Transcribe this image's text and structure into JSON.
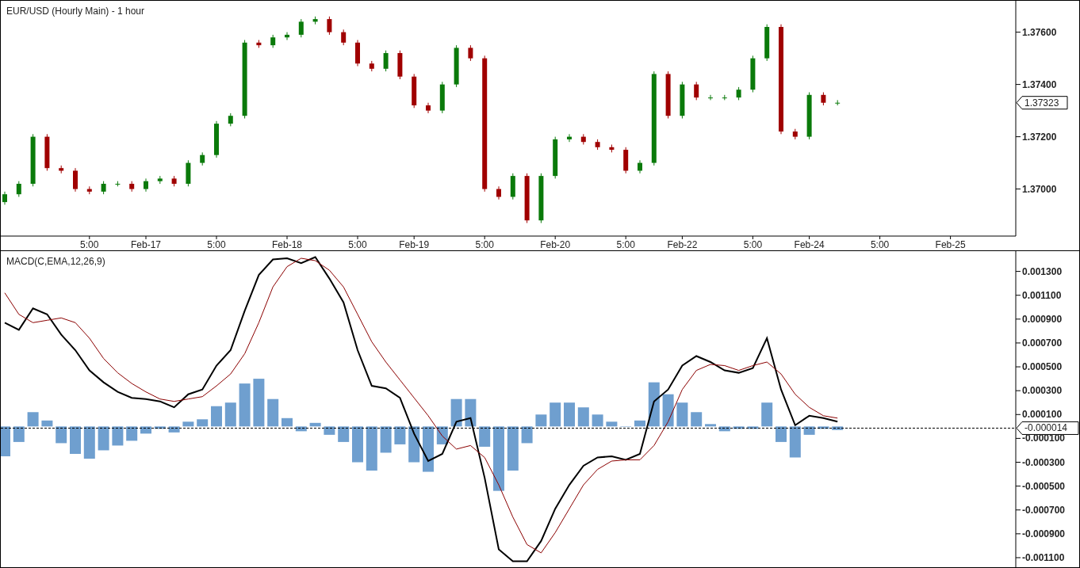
{
  "price_chart": {
    "chart_data": {
      "type": "candlestick",
      "title": "EUR/USD (Hourly Main) - 1 hour",
      "ylim": [
        1.3682,
        1.3772
      ],
      "categories": [
        null,
        null,
        null,
        null,
        null,
        null,
        "5:00",
        null,
        null,
        null,
        "Feb-17",
        null,
        null,
        null,
        null,
        "5:00",
        null,
        null,
        null,
        null,
        "Feb-18",
        null,
        null,
        null,
        null,
        "5:00",
        null,
        null,
        null,
        "Feb-19",
        null,
        null,
        null,
        null,
        "5:00",
        null,
        null,
        null,
        null,
        "Feb-20",
        null,
        null,
        null,
        null,
        "5:00",
        null,
        null,
        null,
        "Feb-22",
        null,
        null,
        null,
        null,
        "5:00",
        null,
        null,
        null,
        "Feb-24",
        null,
        null,
        null,
        null,
        "5:00",
        null,
        null,
        null,
        null,
        "Feb-25",
        null,
        null,
        null,
        null
      ],
      "yticks": [
        {
          "value": 1.376,
          "label": "1.37600"
        },
        {
          "value": 1.374,
          "label": "1.37400"
        },
        {
          "value": 1.372,
          "label": "1.37200"
        },
        {
          "value": 1.37,
          "label": "1.37000"
        }
      ],
      "ohlc": [
        [
          1.3695,
          1.3699,
          1.3694,
          1.3698
        ],
        [
          1.3698,
          1.3703,
          1.3697,
          1.3702
        ],
        [
          1.3702,
          1.3721,
          1.3701,
          1.372
        ],
        [
          1.372,
          1.3721,
          1.3707,
          1.3708
        ],
        [
          1.3708,
          1.3709,
          1.3706,
          1.3707
        ],
        [
          1.3707,
          1.3708,
          1.3699,
          1.37
        ],
        [
          1.37,
          1.3701,
          1.3698,
          1.3699
        ],
        [
          1.3699,
          1.3703,
          1.3698,
          1.3702
        ],
        [
          1.3702,
          1.3703,
          1.3701,
          1.3702
        ],
        [
          1.3702,
          1.3703,
          1.3699,
          1.37
        ],
        [
          1.37,
          1.3704,
          1.3699,
          1.3703
        ],
        [
          1.3703,
          1.3705,
          1.3702,
          1.3704
        ],
        [
          1.3704,
          1.3705,
          1.3701,
          1.3702
        ],
        [
          1.3702,
          1.3711,
          1.3701,
          1.371
        ],
        [
          1.371,
          1.3714,
          1.3709,
          1.3713
        ],
        [
          1.3713,
          1.3726,
          1.3712,
          1.3725
        ],
        [
          1.3725,
          1.3729,
          1.3724,
          1.3728
        ],
        [
          1.3728,
          1.3757,
          1.3727,
          1.3756
        ],
        [
          1.3756,
          1.3757,
          1.3754,
          1.3755
        ],
        [
          1.3755,
          1.3759,
          1.3754,
          1.3758
        ],
        [
          1.3758,
          1.376,
          1.3757,
          1.3759
        ],
        [
          1.3759,
          1.3765,
          1.3758,
          1.3764
        ],
        [
          1.3764,
          1.3766,
          1.3763,
          1.3765
        ],
        [
          1.3765,
          1.3766,
          1.3759,
          1.376
        ],
        [
          1.376,
          1.3761,
          1.3755,
          1.3756
        ],
        [
          1.3756,
          1.3757,
          1.3747,
          1.3748
        ],
        [
          1.3748,
          1.3749,
          1.3745,
          1.3746
        ],
        [
          1.3746,
          1.3753,
          1.3745,
          1.3752
        ],
        [
          1.3752,
          1.3753,
          1.3742,
          1.3743
        ],
        [
          1.3743,
          1.3744,
          1.3731,
          1.3732
        ],
        [
          1.3732,
          1.3733,
          1.3729,
          1.373
        ],
        [
          1.373,
          1.3741,
          1.3729,
          1.374
        ],
        [
          1.374,
          1.3755,
          1.3739,
          1.3754
        ],
        [
          1.3754,
          1.3755,
          1.3749,
          1.375
        ],
        [
          1.375,
          1.3751,
          1.3699,
          1.37
        ],
        [
          1.37,
          1.3701,
          1.3696,
          1.3697
        ],
        [
          1.3697,
          1.3706,
          1.3696,
          1.3705
        ],
        [
          1.3705,
          1.3706,
          1.3687,
          1.3688
        ],
        [
          1.3688,
          1.3706,
          1.3687,
          1.3705
        ],
        [
          1.3705,
          1.372,
          1.3704,
          1.3719
        ],
        [
          1.3719,
          1.3721,
          1.3718,
          1.372
        ],
        [
          1.372,
          1.3721,
          1.3717,
          1.3718
        ],
        [
          1.3718,
          1.3719,
          1.3715,
          1.3716
        ],
        [
          1.3716,
          1.3717,
          1.3714,
          1.3715
        ],
        [
          1.3715,
          1.3716,
          1.3706,
          1.3707
        ],
        [
          1.3707,
          1.3711,
          1.3706,
          1.371
        ],
        [
          1.371,
          1.3745,
          1.3709,
          1.3744
        ],
        [
          1.3744,
          1.3745,
          1.3727,
          1.3728
        ],
        [
          1.3728,
          1.3741,
          1.3727,
          1.374
        ],
        [
          1.374,
          1.3741,
          1.3734,
          1.3735
        ],
        [
          1.3735,
          1.3736,
          1.3734,
          1.3735
        ],
        [
          1.3735,
          1.3736,
          1.3734,
          1.3735
        ],
        [
          1.3735,
          1.3739,
          1.3734,
          1.3738
        ],
        [
          1.3738,
          1.3751,
          1.3737,
          1.375
        ],
        [
          1.375,
          1.3763,
          1.3749,
          1.3762
        ],
        [
          1.3762,
          1.3763,
          1.3721,
          1.3722
        ],
        [
          1.3722,
          1.3723,
          1.3719,
          1.372
        ],
        [
          1.372,
          1.3737,
          1.3719,
          1.3736
        ],
        [
          1.3736,
          1.3737,
          1.3732,
          1.3733
        ],
        [
          1.3733,
          1.3734,
          1.3732,
          1.3733
        ],
        null,
        null,
        null,
        null,
        null,
        null,
        null,
        null,
        null,
        null,
        null,
        null
      ],
      "annotations": [
        "1.37323"
      ]
    }
  },
  "macd_chart": {
    "chart_data": {
      "type": "line",
      "title": "MACD(C,EMA,12,26,9)",
      "ylim": [
        -0.00118,
        0.00147
      ],
      "yticks": [
        {
          "value": 0.0013,
          "label": "0.001300"
        },
        {
          "value": 0.0011,
          "label": "0.001100"
        },
        {
          "value": 0.0009,
          "label": "0.000900"
        },
        {
          "value": 0.0007,
          "label": "0.000700"
        },
        {
          "value": 0.0005,
          "label": "0.000500"
        },
        {
          "value": 0.0003,
          "label": "0.000300"
        },
        {
          "value": 0.0001,
          "label": "0.000100"
        },
        {
          "value": -0.0001,
          "label": "-0.000100"
        },
        {
          "value": -0.0003,
          "label": "-0.000300"
        },
        {
          "value": -0.0005,
          "label": "-0.000500"
        },
        {
          "value": -0.0007,
          "label": "-0.000700"
        },
        {
          "value": -0.0009,
          "label": "-0.000900"
        },
        {
          "value": -0.0011,
          "label": "-0.001100"
        }
      ],
      "series": [
        {
          "type": "bar",
          "color": "#6f9fcf",
          "values": [
            -0.00025,
            -0.00013,
            0.00012,
            5e-05,
            -0.00014,
            -0.00023,
            -0.00027,
            -0.0002,
            -0.00016,
            -0.00012,
            -6e-05,
            -2e-05,
            -5e-05,
            4e-05,
            6e-05,
            0.00017,
            0.0002,
            0.00036,
            0.0004,
            0.00023,
            7e-05,
            -4e-05,
            3e-05,
            -7e-05,
            -0.00013,
            -0.0003,
            -0.00037,
            -0.00022,
            -0.00015,
            -0.0003,
            -0.00038,
            -0.00015,
            0.00023,
            0.00023,
            -0.00017,
            -0.00054,
            -0.00037,
            -0.00014,
            0.0001,
            0.0002,
            0.0002,
            0.00016,
            0.0001,
            4e-05,
            0,
            5e-05,
            0.00037,
            0.00027,
            0.0002,
            0.00012,
            2e-05,
            -4e-05,
            -2e-05,
            -2e-05,
            0.0002,
            -0.00013,
            -0.00026,
            -7e-05,
            -2e-05,
            -3e-05
          ]
        },
        {
          "type": "line",
          "color": "#000000",
          "values": [
            0.00087,
            0.00081,
            0.00099,
            0.00094,
            0.00077,
            0.00064,
            0.00047,
            0.00037,
            0.00029,
            0.00024,
            0.00023,
            0.00021,
            0.00016,
            0.00027,
            0.00031,
            0.00051,
            0.00064,
            0.00097,
            0.00127,
            0.0014,
            0.00141,
            0.00137,
            0.00142,
            0.00124,
            0.00104,
            0.00064,
            0.00034,
            0.00032,
            0.00024,
            -6e-05,
            -0.00029,
            -0.00023,
            4e-05,
            7e-05,
            -0.00043,
            -0.00103,
            -0.00113,
            -0.00113,
            -0.00096,
            -0.00069,
            -0.00049,
            -0.00033,
            -0.00026,
            -0.00025,
            -0.00028,
            -0.00023,
            0.00021,
            0.00031,
            0.00051,
            0.00059,
            0.00054,
            0.00047,
            0.00045,
            0.00049,
            0.00074,
            0.00031,
            1e-05,
            9e-05,
            7e-05,
            4e-05
          ]
        },
        {
          "type": "line",
          "color": "#8b0000",
          "values": [
            0.00112,
            0.00094,
            0.00087,
            0.00089,
            0.00091,
            0.00087,
            0.00074,
            0.00057,
            0.00045,
            0.00036,
            0.00029,
            0.00023,
            0.00021,
            0.00023,
            0.00025,
            0.00034,
            0.00044,
            0.00061,
            0.00087,
            0.00117,
            0.00134,
            0.00141,
            0.00139,
            0.00131,
            0.00117,
            0.00094,
            0.00071,
            0.00054,
            0.00039,
            0.00024,
            9e-05,
            -8e-05,
            -0.00019,
            -0.00016,
            -0.00026,
            -0.00049,
            -0.00076,
            -0.00099,
            -0.00106,
            -0.00089,
            -0.00069,
            -0.00049,
            -0.00036,
            -0.00029,
            -0.00028,
            -0.00028,
            -0.00016,
            4e-05,
            0.00031,
            0.00047,
            0.00052,
            0.00051,
            0.00047,
            0.00051,
            0.00054,
            0.00044,
            0.00027,
            0.00016,
            9e-05,
            7e-05
          ]
        }
      ],
      "ref_lines": [
        {
          "axis": "y",
          "value": -1.4e-05,
          "label": "-0.000014"
        }
      ]
    }
  }
}
